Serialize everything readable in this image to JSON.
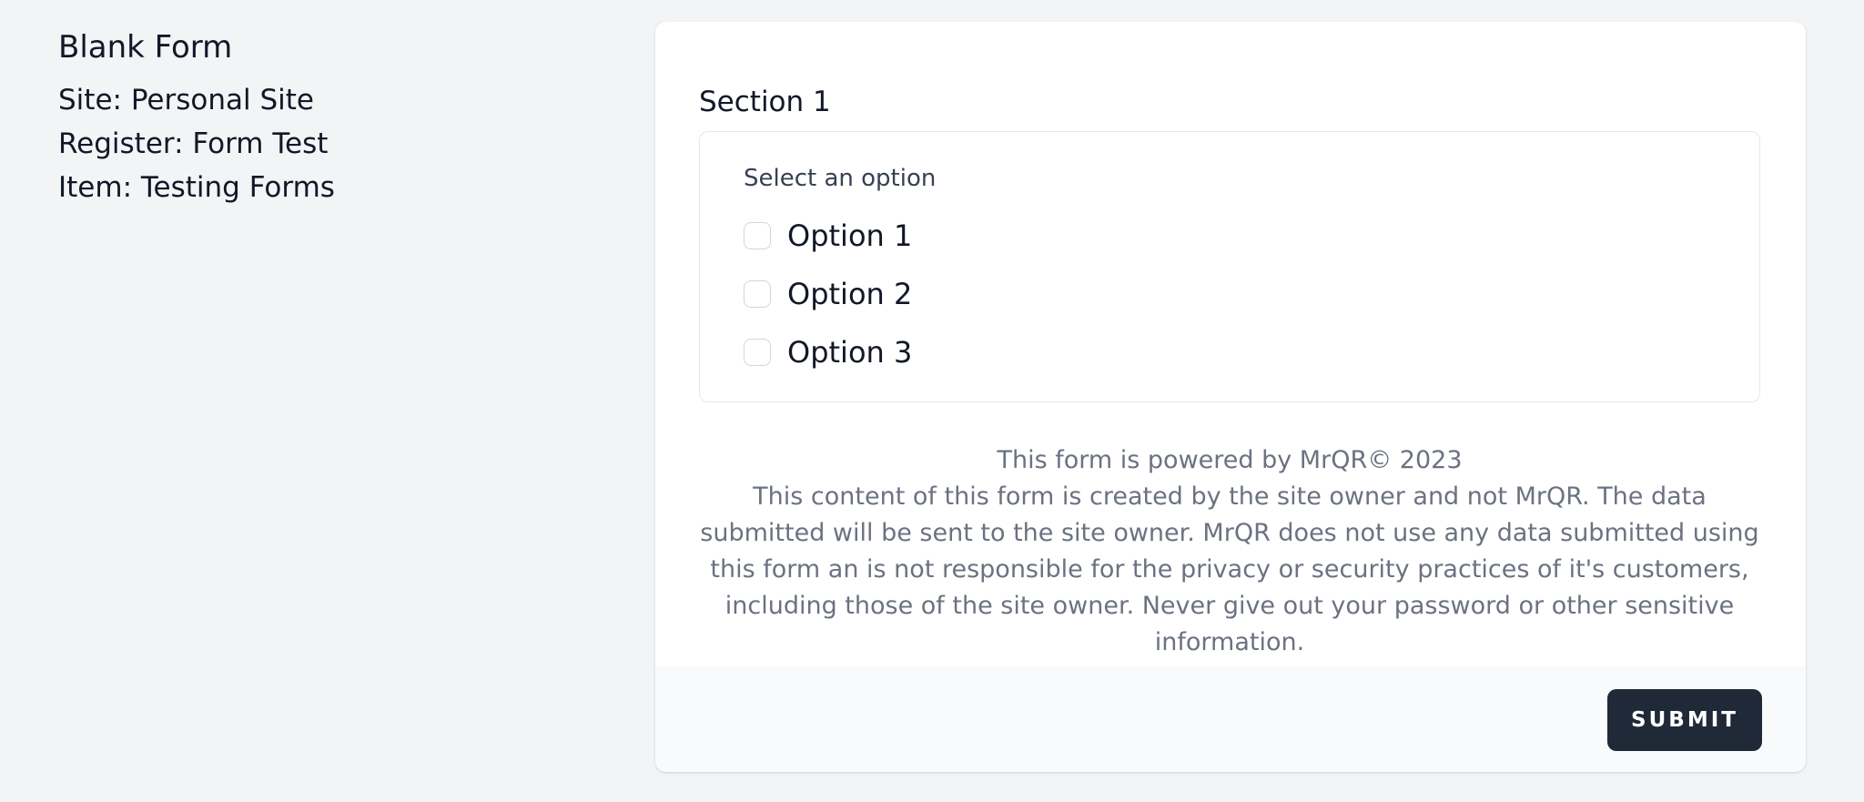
{
  "info": {
    "title": "Blank Form",
    "site": "Site: Personal Site",
    "register": "Register: Form Test",
    "item": "Item: Testing Forms"
  },
  "form": {
    "section_title": "Section 1",
    "question": {
      "label": "Select an option",
      "options": [
        {
          "label": "Option 1",
          "checked": false
        },
        {
          "label": "Option 2",
          "checked": false
        },
        {
          "label": "Option 3",
          "checked": false
        }
      ]
    },
    "footer": {
      "powered_by": "This form is powered by MrQR© 2023",
      "disclaimer": "This content of this form is created by the site owner and not MrQR. The data submitted will be sent to the site owner. MrQR does not use any data submitted using this form an is not responsible for the privacy or security practices of it's customers, including those of the site owner. Never give out your password or other sensitive information."
    },
    "submit_label": "SUBMIT"
  },
  "colors": {
    "page_background": "#f3f4f6",
    "card_background": "#ffffff",
    "footer_background": "#f9fafb",
    "button_background": "#1f2937",
    "muted_text": "#6b7280"
  }
}
